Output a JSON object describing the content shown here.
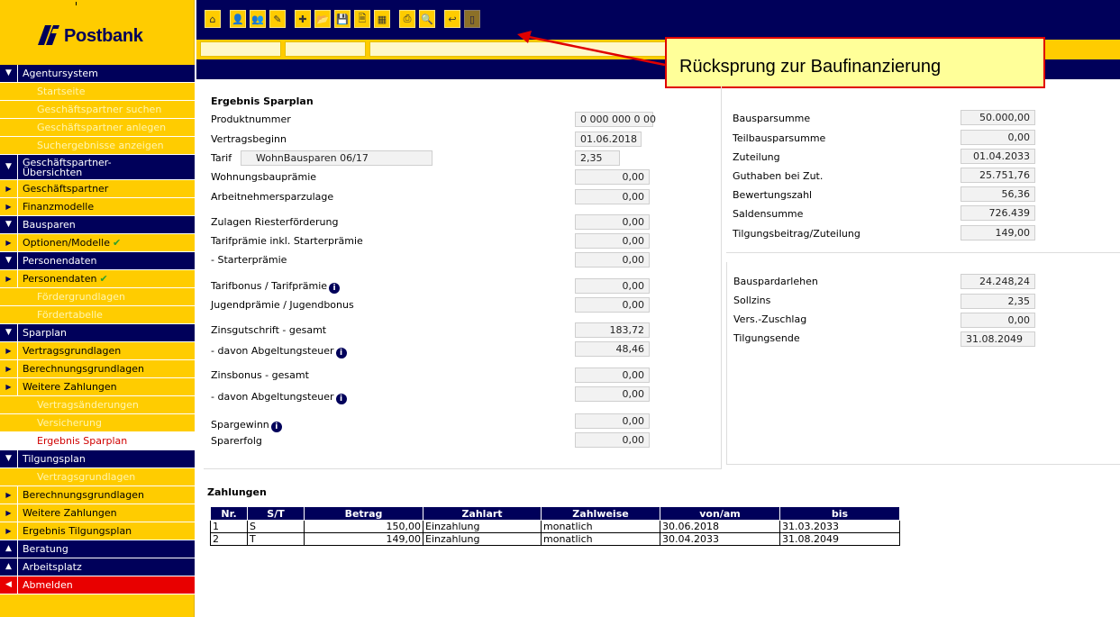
{
  "logo": {
    "text": "Postbank"
  },
  "nav": {
    "agentursystem": "Agentursystem",
    "startseite": "Startseite",
    "gp_suchen": "Geschäftspartner suchen",
    "gp_anlegen": "Geschäftspartner anlegen",
    "suchergebnisse": "Suchergebnisse anzeigen",
    "gp_uebersichten_1": "Geschäftspartner-",
    "gp_uebersichten_2": "Übersichten",
    "geschaeftspartner": "Geschäftspartner",
    "finanzmodelle": "Finanzmodelle",
    "bausparen": "Bausparen",
    "optionen": "Optionen/Modelle",
    "personendaten_section": "Personendaten",
    "personendaten": "Personendaten",
    "foerdergrundlagen": "Fördergrundlagen",
    "foerdertabelle": "Fördertabelle",
    "sparplan": "Sparplan",
    "vertragsgrundlagen": "Vertragsgrundlagen",
    "berechnungsgrundlagen": "Berechnungsgrundlagen",
    "weitere_zahlungen": "Weitere Zahlungen",
    "vertragsaenderungen": "Vertragsänderungen",
    "versicherung": "Versicherung",
    "ergebnis_sparplan": "Ergebnis Sparplan",
    "tilgungsplan": "Tilgungsplan",
    "t_vertragsgrundlagen": "Vertragsgrundlagen",
    "t_berechnungsgrundlagen": "Berechnungsgrundlagen",
    "t_weitere_zahlungen": "Weitere Zahlungen",
    "ergebnis_tilgungsplan": "Ergebnis Tilgungsplan",
    "beratung": "Beratung",
    "arbeitsplatz": "Arbeitsplatz",
    "abmelden": "Abmelden"
  },
  "callout": {
    "text": "Rücksprung zur Baufinanzierung"
  },
  "ergebnis": {
    "title": "Ergebnis Sparplan",
    "produktnummer_label": "Produktnummer",
    "produktnummer_value": "0 000 000 0 00",
    "vertragsbeginn_label": "Vertragsbeginn",
    "vertragsbeginn_value": "01.06.2018",
    "tarif_label": "Tarif",
    "tarif_name": "WohnBausparen 06/17",
    "tarif_value": "2,35",
    "wohnungsbaupraemie_label": "Wohnungsbauprämie",
    "wohnungsbaupraemie_value": "0,00",
    "arbeitnehmersparzulage_label": "Arbeitnehmersparzulage",
    "arbeitnehmersparzulage_value": "0,00",
    "zulagen_label": "Zulagen Riesterförderung",
    "zulagen_value": "0,00",
    "tarifpraemie_label": "Tarifprämie inkl. Starterprämie",
    "tarifpraemie_value": "0,00",
    "starterpraemie_label": "- Starterprämie",
    "starterpraemie_value": "0,00",
    "tarifbonus_label": "Tarifbonus / Tarifprämie",
    "tarifbonus_value": "0,00",
    "jugendpraemie_label": "Jugendprämie / Jugendbonus",
    "jugendpraemie_value": "0,00",
    "zinsgutschrift_label": "Zinsgutschrift - gesamt",
    "zinsgutschrift_value": "183,72",
    "abgeltung1_label": "- davon Abgeltungsteuer",
    "abgeltung1_value": "48,46",
    "zinsbonus_label": "Zinsbonus - gesamt",
    "zinsbonus_value": "0,00",
    "abgeltung2_label": "- davon Abgeltungsteuer",
    "abgeltung2_value": "0,00",
    "spargewinn_label": "Spargewinn",
    "spargewinn_value": "0,00",
    "sparerfolg_label": "Sparerfolg",
    "sparerfolg_value": "0,00"
  },
  "right_top": {
    "bausparsumme_label": "Bausparsumme",
    "bausparsumme_value": "50.000,00",
    "teilbausparsumme_label": "Teilbausparsumme",
    "teilbausparsumme_value": "0,00",
    "zuteilung_label": "Zuteilung",
    "zuteilung_value": "01.04.2033",
    "guthaben_label": "Guthaben bei Zut.",
    "guthaben_value": "25.751,76",
    "bewertungszahl_label": "Bewertungszahl",
    "bewertungszahl_value": "56,36",
    "saldensumme_label": "Saldensumme",
    "saldensumme_value": "726.439",
    "tilgungsbeitrag_label": "Tilgungsbeitrag/Zuteilung",
    "tilgungsbeitrag_value": "149,00"
  },
  "right_bottom": {
    "darlehen_label": "Bauspardarlehen",
    "darlehen_value": "24.248,24",
    "sollzins_label": "Sollzins",
    "sollzins_value": "2,35",
    "zuschlag_label": "Vers.-Zuschlag",
    "zuschlag_value": "0,00",
    "tilgungsende_label": "Tilgungsende",
    "tilgungsende_value": "31.08.2049"
  },
  "zahlungen": {
    "title": "Zahlungen",
    "headers": [
      "Nr.",
      "S/T",
      "Betrag",
      "Zahlart",
      "Zahlweise",
      "von/am",
      "bis"
    ],
    "rows": [
      [
        "1",
        "S",
        "150,00",
        "Einzahlung",
        "monatlich",
        "30.06.2018",
        "31.03.2033"
      ],
      [
        "2",
        "T",
        "149,00",
        "Einzahlung",
        "monatlich",
        "30.04.2033",
        "31.08.2049"
      ]
    ]
  },
  "colors": {
    "brand_yellow": "#ffcc00",
    "brand_blue": "#00005a",
    "logout_red": "#e80000",
    "callout_border": "#e00000",
    "callout_bg": "#ffff99"
  }
}
